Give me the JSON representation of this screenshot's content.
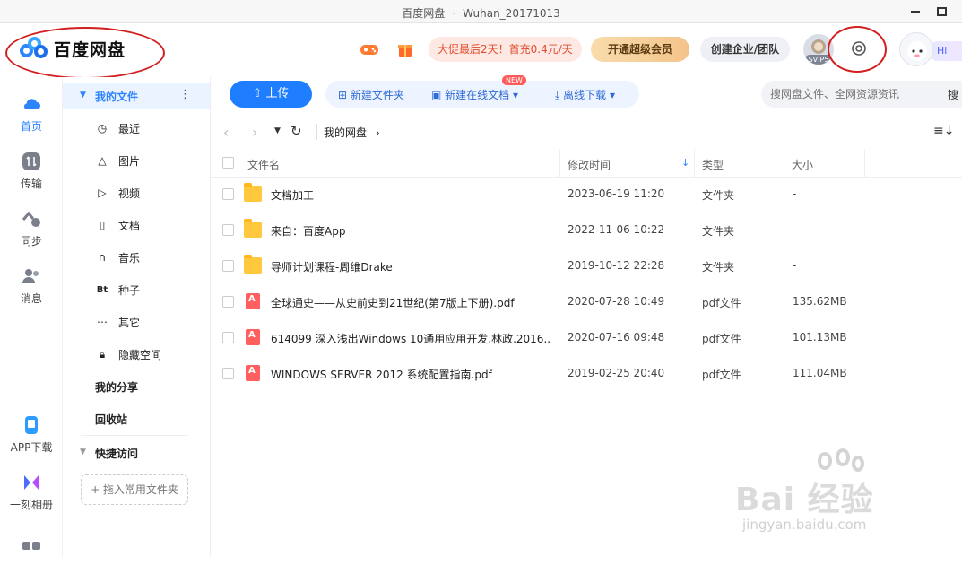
{
  "window": {
    "app_name": "百度网盘",
    "separator": "·",
    "user_name": "Wuhan_20171013"
  },
  "header": {
    "logo_text": "百度网盘",
    "promo_text": "大促最后2天！首充0.4元/天",
    "vip_label": "开通超级会员",
    "team_label": "创建企业/团队",
    "avatar_badge": "SVIP5",
    "hi_label": "Hi",
    "icons": [
      "game-icon",
      "gift-icon",
      "gear-icon"
    ]
  },
  "rail": {
    "items": [
      {
        "label": "首页",
        "icon": "cloud-icon"
      },
      {
        "label": "传输",
        "icon": "transfer-icon"
      },
      {
        "label": "同步",
        "icon": "sync-icon"
      },
      {
        "label": "消息",
        "icon": "message-icon"
      },
      {
        "label": "APP下载",
        "icon": "phone-icon"
      },
      {
        "label": "一刻相册",
        "icon": "album-icon"
      }
    ],
    "accent": "#2e84ff"
  },
  "sidebar": {
    "section_title": "我的文件",
    "items": [
      {
        "label": "最近",
        "icon": "clock-icon"
      },
      {
        "label": "图片",
        "icon": "image-icon"
      },
      {
        "label": "视频",
        "icon": "play-icon"
      },
      {
        "label": "文档",
        "icon": "document-icon"
      },
      {
        "label": "音乐",
        "icon": "headphones-icon"
      },
      {
        "label": "种子",
        "icon": "bt-icon",
        "glyph": "Bt"
      },
      {
        "label": "其它",
        "icon": "more-icon"
      },
      {
        "label": "隐藏空间",
        "icon": "lock-icon"
      }
    ],
    "my_share": "我的分享",
    "recycle": "回收站",
    "quick_access": "快捷访问",
    "drop_hint": "+ 拖入常用文件夹"
  },
  "toolbar": {
    "upload": "上传",
    "new_folder": "新建文件夹",
    "new_online_doc": "新建在线文档",
    "new_tag": "NEW",
    "offline_download": "离线下载",
    "search_placeholder": "搜网盘文件、全网资源资讯",
    "search_label": "搜"
  },
  "nav": {
    "breadcrumb": "我的网盘",
    "breadcrumb_arrow": "›"
  },
  "table": {
    "headers": {
      "name": "文件名",
      "modified": "修改时间",
      "type": "类型",
      "size": "大小"
    },
    "rows": [
      {
        "kind": "folder",
        "name": "文档加工",
        "modified": "2023-06-19 11:20",
        "type": "文件夹",
        "size": "-"
      },
      {
        "kind": "folder",
        "name": "来自：百度App",
        "modified": "2022-11-06 10:22",
        "type": "文件夹",
        "size": "-"
      },
      {
        "kind": "folder",
        "name": "导师计划课程-周维Drake",
        "modified": "2019-10-12 22:28",
        "type": "文件夹",
        "size": "-"
      },
      {
        "kind": "pdf",
        "name": "全球通史——从史前史到21世纪(第7版上下册).pdf",
        "modified": "2020-07-28 10:49",
        "type": "pdf文件",
        "size": "135.62MB"
      },
      {
        "kind": "pdf",
        "name": "614099 深入浅出Windows 10通用应用开发.林政.2016....",
        "modified": "2020-07-16 09:48",
        "type": "pdf文件",
        "size": "101.13MB"
      },
      {
        "kind": "pdf",
        "name": "WINDOWS SERVER 2012 系统配置指南.pdf",
        "modified": "2019-02-25 20:40",
        "type": "pdf文件",
        "size": "111.04MB"
      }
    ]
  },
  "watermark": {
    "text": "Bai 经验",
    "url": "jingyan.baidu.com"
  }
}
